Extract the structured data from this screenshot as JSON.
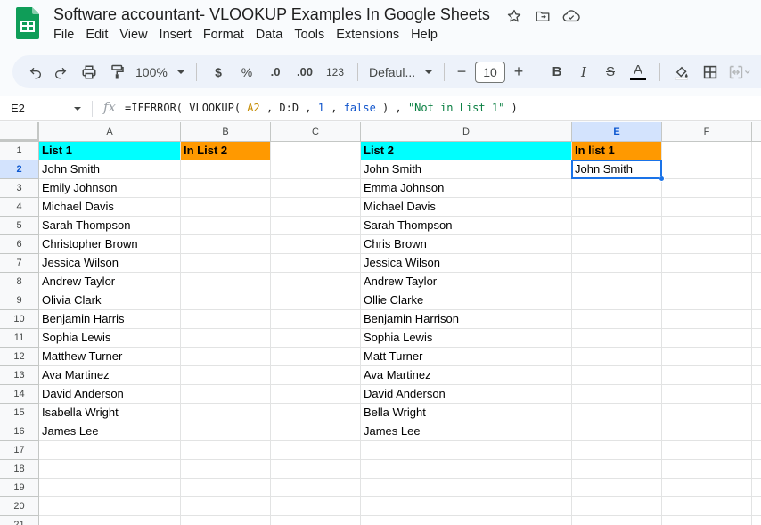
{
  "app": {
    "title": "Software accountant- VLOOKUP Examples In Google Sheets",
    "icons": [
      "star-icon",
      "move-to-folder-icon",
      "cloud-saved-icon"
    ]
  },
  "menu": [
    "File",
    "Edit",
    "View",
    "Insert",
    "Format",
    "Data",
    "Tools",
    "Extensions",
    "Help"
  ],
  "toolbar": {
    "zoom": "100%",
    "currency_label": "$",
    "percent_label": "%",
    "decrease_decimal_label": ".0",
    "increase_decimal_label": ".00",
    "number_format_label": "123",
    "font": "Defaul...",
    "font_size": "10",
    "font_size_minus": "−",
    "font_size_plus": "+",
    "bold_label": "B",
    "italic_label": "I",
    "strike_label": "S",
    "text_color_label": "A"
  },
  "formula_bar": {
    "name_box": "E2",
    "fx_label": "fx",
    "formula": {
      "p1": "=IFERROR( VLOOKUP( ",
      "ref": "A2",
      "p2": " , D:D , ",
      "num": "1",
      "p3": " , ",
      "bool": "false",
      "p4": " ) , ",
      "str": "\"Not in List 1\"",
      "p5": " )"
    }
  },
  "columns": [
    "A",
    "B",
    "C",
    "D",
    "E",
    "F"
  ],
  "rows": [
    "1",
    "2",
    "3",
    "4",
    "5",
    "6",
    "7",
    "8",
    "9",
    "10",
    "11",
    "12",
    "13",
    "14",
    "15",
    "16",
    "17",
    "18",
    "19",
    "20",
    "21"
  ],
  "selected_cell": "E2",
  "colors": {
    "cyan_header": "#00ffff",
    "orange_header": "#ff9900",
    "selection": "#1a73e8",
    "selected_header_bg": "#d3e3fd"
  },
  "sheet": {
    "A1": "List 1",
    "B1": "In List 2",
    "D1": "List 2",
    "E1": "In list 1",
    "E2": "John Smith",
    "list1": [
      "John Smith",
      "Emily Johnson",
      "Michael Davis",
      "Sarah Thompson",
      "Christopher Brown",
      "Jessica Wilson",
      "Andrew Taylor",
      "Olivia Clark",
      "Benjamin Harris",
      "Sophia Lewis",
      "Matthew Turner",
      "Ava Martinez",
      "David Anderson",
      "Isabella Wright",
      "James Lee"
    ],
    "list2": [
      "John Smith",
      "Emma Johnson",
      "Michael Davis",
      "Sarah Thompson",
      "Chris Brown",
      "Jessica Wilson",
      "Andrew Taylor",
      "Ollie Clarke",
      "Benjamin Harrison",
      "Sophia Lewis",
      "Matt Turner",
      "Ava Martinez",
      "David Anderson",
      "Bella Wright",
      "James Lee"
    ]
  }
}
